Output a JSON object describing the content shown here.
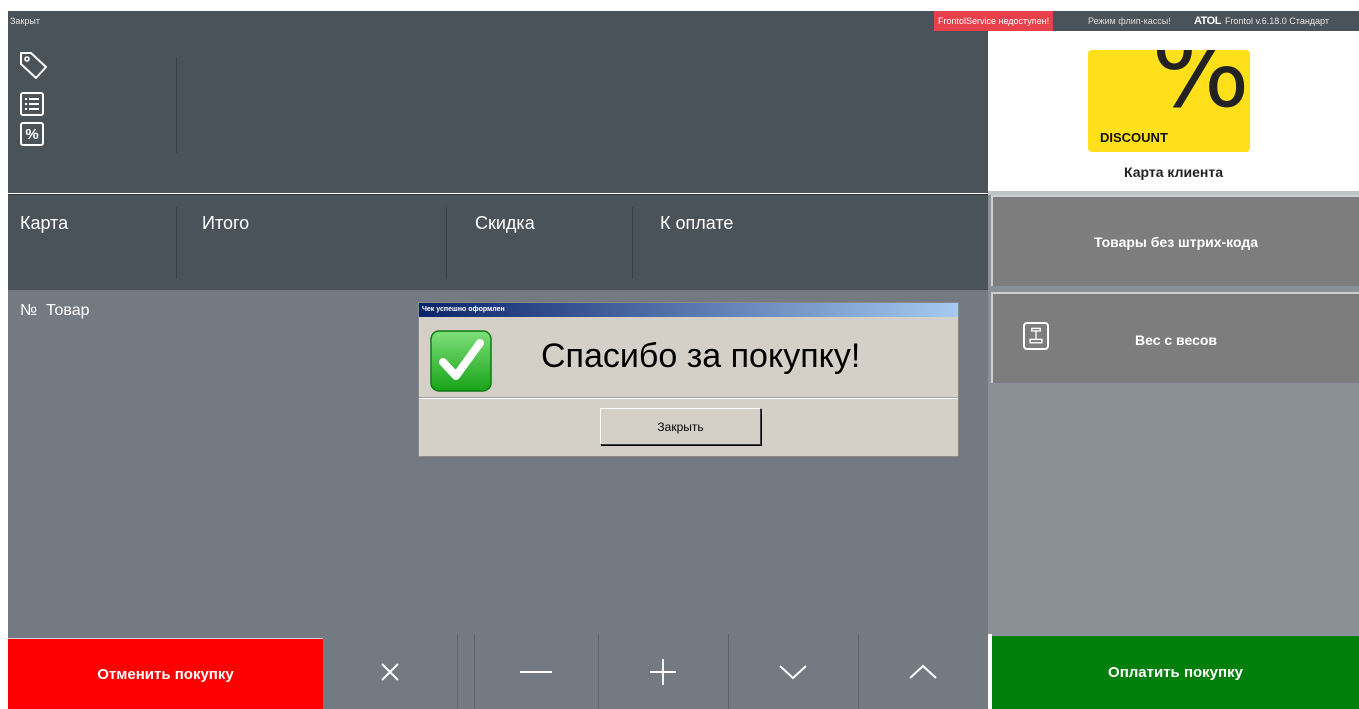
{
  "status_bar": {
    "state": "Закрыт",
    "service_warning": "FrontolService недоступен!",
    "flip_mode": "Режим флип-кассы!",
    "brand_logo": "ATOL",
    "version": "Frontol v.6.18.0 Стандарт"
  },
  "side_icons": [
    "tag-icon",
    "receipt-list-icon",
    "percent-icon"
  ],
  "percent_icon_text": "%",
  "totals": {
    "card": "Карта",
    "total": "Итого",
    "discount": "Скидка",
    "to_pay": "К оплате"
  },
  "list": {
    "num_header": "№",
    "product_header": "Товар"
  },
  "dialog": {
    "title": "Чек успешно оформлен",
    "message": "Спасибо за покупку!",
    "close_label": "Закрыть"
  },
  "right_panel": {
    "discount_image_text": "DISCOUNT",
    "discount_symbol": "%",
    "client_card_label": "Карта клиента",
    "no_barcode_label": "Товары без штрих-кода",
    "weight_label": "Вес с весов"
  },
  "bottom_bar": {
    "cancel_label": "Отменить покупку",
    "pay_label": "Оплатить покупку",
    "keys": [
      "close-icon",
      "minus-icon",
      "plus-icon",
      "chevron-down-icon",
      "chevron-up-icon"
    ]
  },
  "colors": {
    "panel_dark": "#4a525a",
    "panel_mid": "#747a82",
    "cancel_red": "#fe0000",
    "pay_green": "#00800a",
    "discount_yellow": "#ffe01a",
    "warning_red": "#e8414c"
  }
}
